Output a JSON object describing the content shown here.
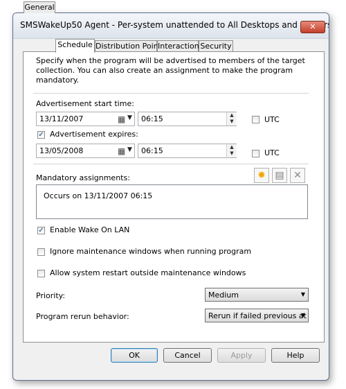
{
  "window": {
    "title": "SMSWakeUp50 Agent - Per-system unattended to All Desktops and Servers Pro...",
    "close_glyph": "✕"
  },
  "tabs": [
    {
      "label": "General"
    },
    {
      "label": "Schedule"
    },
    {
      "label": "Distribution Points"
    },
    {
      "label": "Interaction"
    },
    {
      "label": "Security"
    }
  ],
  "schedule": {
    "description": "Specify when the program will be advertised to members of the target collection. You can also create an assignment to make the program mandatory.",
    "start_label": "Advertisement start time:",
    "start_date": "13/11/2007",
    "start_time": "06:15",
    "utc_label": "UTC",
    "expires_label": "Advertisement expires:",
    "expire_date": "13/05/2008",
    "expire_time": "06:15",
    "mandatory_label": "Mandatory assignments:",
    "assignments": [
      "Occurs on 13/11/2007 06:15"
    ],
    "wake_on_lan": "Enable Wake On LAN",
    "ignore_maint": "Ignore maintenance windows when running program",
    "allow_restart": "Allow system restart outside maintenance windows",
    "priority_label": "Priority:",
    "priority_value": "Medium",
    "rerun_label": "Program rerun behavior:",
    "rerun_value": "Rerun if failed previous at"
  },
  "buttons": {
    "ok": "OK",
    "cancel": "Cancel",
    "apply": "Apply",
    "help": "Help"
  },
  "icons": {
    "new": "new-star-icon",
    "properties": "properties-icon",
    "delete": "delete-x-icon",
    "calendar": "calendar-icon"
  }
}
